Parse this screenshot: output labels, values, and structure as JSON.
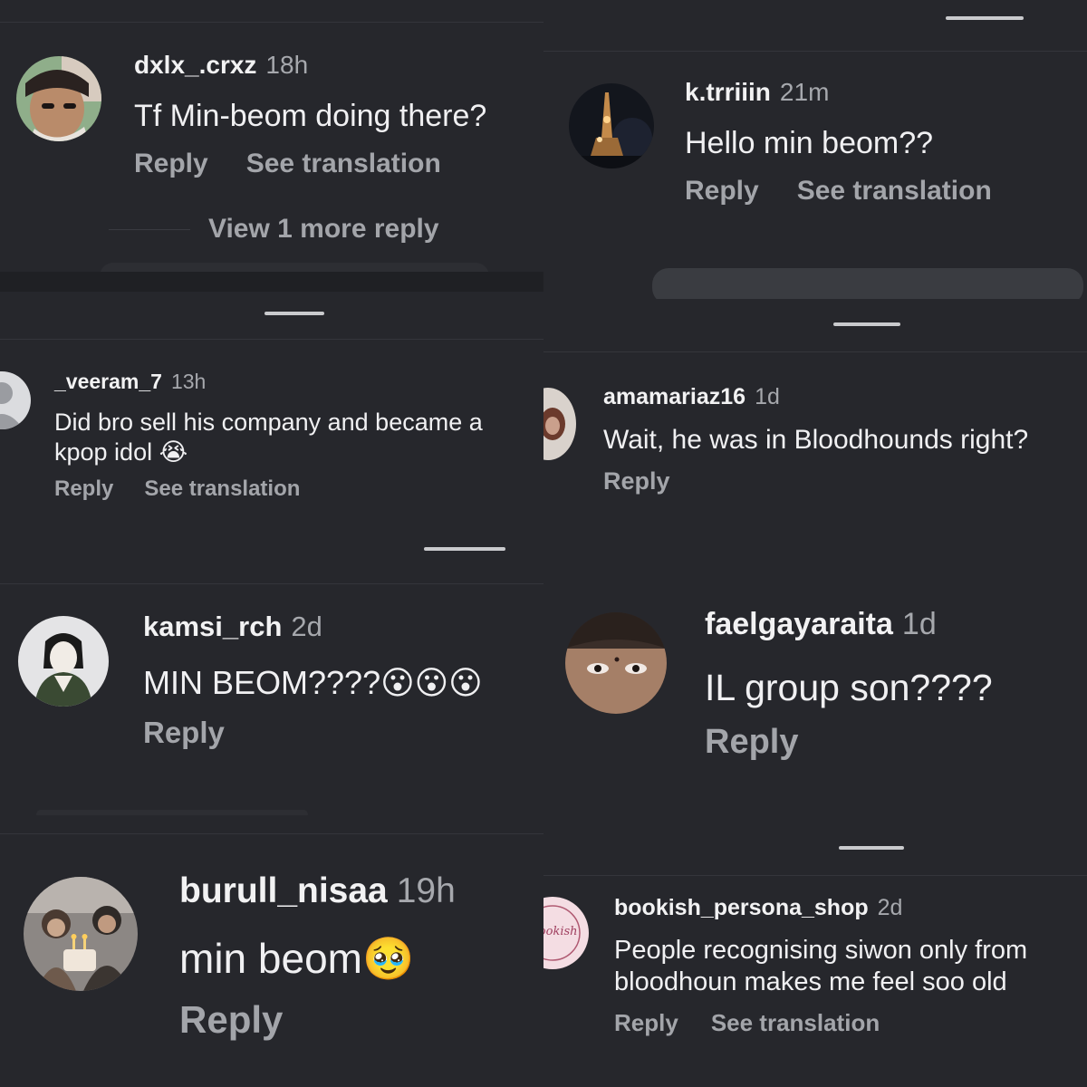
{
  "panels": [
    {
      "username": "dxlx_.crxz",
      "time": "18h",
      "text": "Tf Min-beom doing there?",
      "reply": "Reply",
      "translate": "See translation",
      "more": "View 1 more reply"
    },
    {
      "username": "k.trriiin",
      "time": "21m",
      "text": "Hello min beom??",
      "reply": "Reply",
      "translate": "See translation"
    },
    {
      "username": "_veeram_7",
      "time": "13h",
      "text": "Did bro sell his company and became a kpop idol 😭",
      "reply": "Reply",
      "translate": "See translation"
    },
    {
      "username": "amamariaz16",
      "time": "1d",
      "text": "Wait, he was in Bloodhounds right?",
      "reply": "Reply"
    },
    {
      "username": "kamsi_rch",
      "time": "2d",
      "text": "MIN BEOM????😮😮😮",
      "reply": "Reply"
    },
    {
      "username": "faelgayaraita",
      "time": "1d",
      "text": "IL group son????",
      "reply": "Reply"
    },
    {
      "username": "burull_nisaa",
      "time": "19h",
      "text": "min beom🥹",
      "reply": "Reply"
    },
    {
      "username": "bookish_persona_shop",
      "time": "2d",
      "text": "People recognising siwon only from bloodhoun makes me feel soo old",
      "reply": "Reply",
      "translate": "See translation",
      "avatar_text": "bookish persona"
    }
  ],
  "icons": {
    "default_avatar": "person-silhouette-icon"
  },
  "colors": {
    "background": "#26272c",
    "text": "#f0f0f2",
    "muted": "#a3a5aa"
  }
}
